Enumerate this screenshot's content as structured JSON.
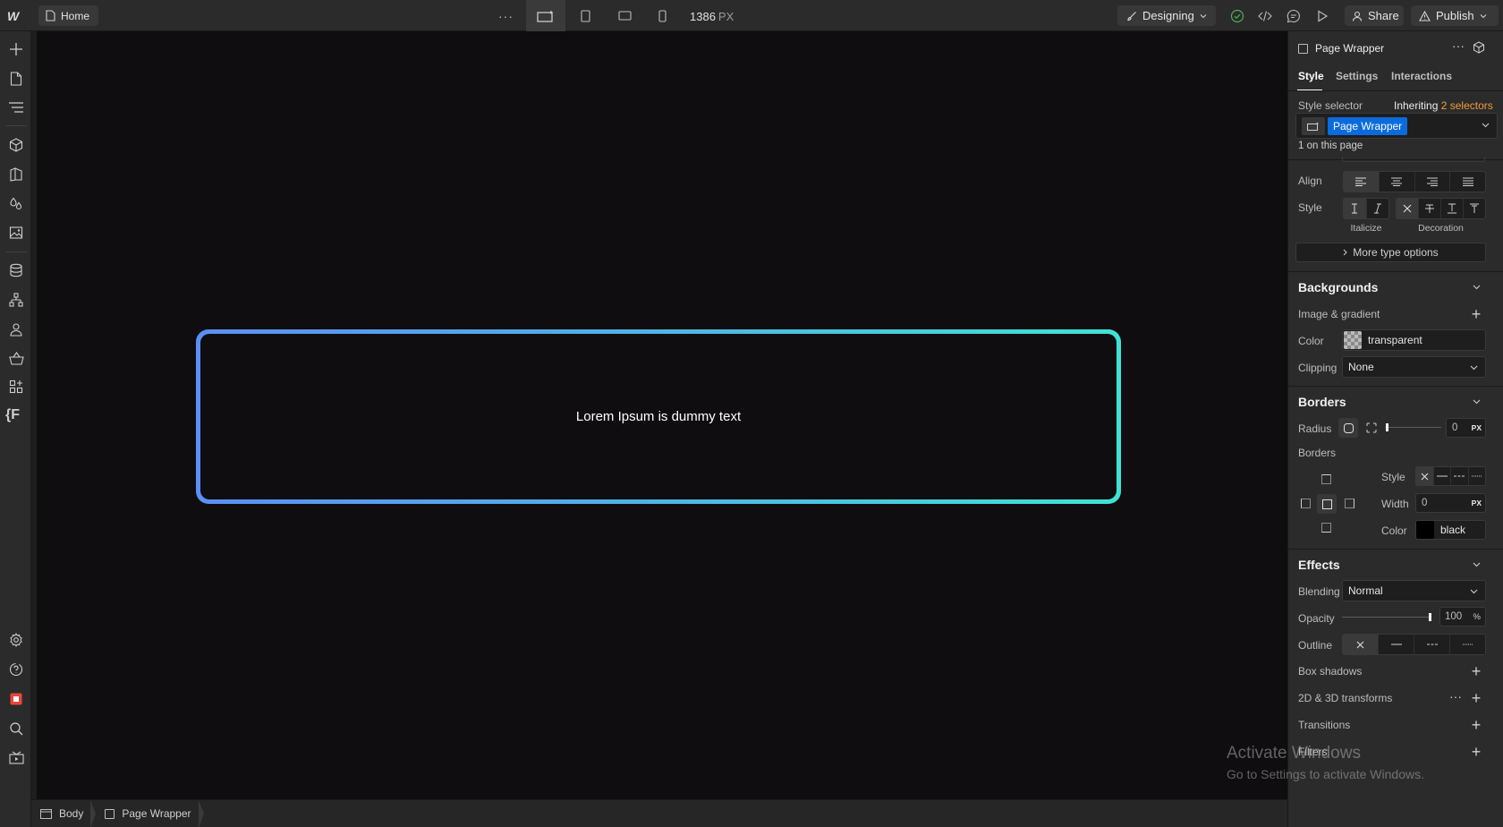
{
  "topbar": {
    "page_name": "Home",
    "more": "···",
    "canvas_width": "1386",
    "canvas_unit": "PX",
    "mode": "Designing",
    "share": "Share",
    "publish": "Publish"
  },
  "canvas": {
    "text": "Lorem Ipsum is dummy text",
    "gradient_colors": [
      "#5b8ff5",
      "#3fe3d3"
    ]
  },
  "breadcrumb": [
    "Body",
    "Page Wrapper"
  ],
  "panel": {
    "element_name": "Page Wrapper",
    "tabs": [
      "Style",
      "Settings",
      "Interactions"
    ],
    "active_tab": "Style",
    "style_selector_label": "Style selector",
    "inheriting": "Inheriting",
    "inheriting_count": "2 selectors",
    "selector_chip": "Page Wrapper",
    "on_page": "1 on this page",
    "typography": {
      "align_label": "Align",
      "style_label": "Style",
      "italicize": "Italicize",
      "decoration": "Decoration",
      "more": "More type options"
    },
    "backgrounds": {
      "title": "Backgrounds",
      "image_gradient": "Image & gradient",
      "color_label": "Color",
      "color_value": "transparent",
      "clipping_label": "Clipping",
      "clipping_value": "None"
    },
    "borders": {
      "title": "Borders",
      "radius_label": "Radius",
      "radius_value": "0",
      "radius_unit": "PX",
      "borders_label": "Borders",
      "style_label": "Style",
      "width_label": "Width",
      "width_value": "0",
      "width_unit": "PX",
      "color_label": "Color",
      "color_value": "black"
    },
    "effects": {
      "title": "Effects",
      "blending_label": "Blending",
      "blending_value": "Normal",
      "opacity_label": "Opacity",
      "opacity_value": "100",
      "opacity_unit": "%",
      "outline_label": "Outline",
      "box_shadows": "Box shadows",
      "transforms": "2D & 3D transforms",
      "transitions": "Transitions",
      "filters": "Filters"
    }
  },
  "watermark": {
    "line1": "Activate Windows",
    "line2": "Go to Settings to activate Windows."
  },
  "colors": {
    "accent_blue": "#0b6bdd",
    "accent_orange": "#f29c38",
    "status_green": "#4caf50"
  }
}
